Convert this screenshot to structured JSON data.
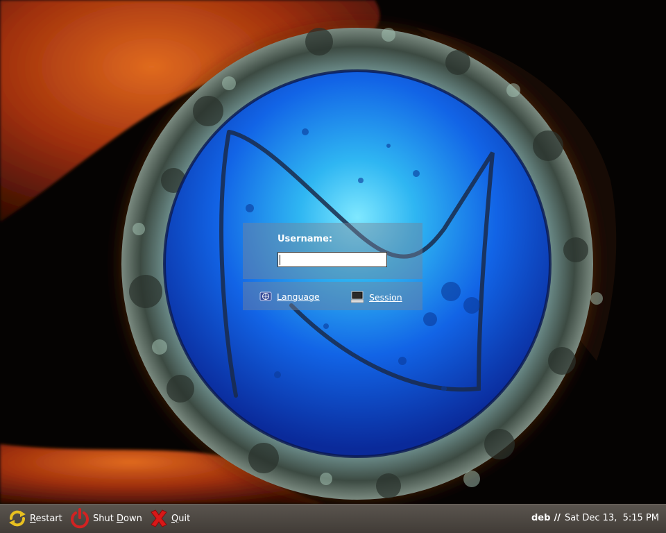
{
  "login": {
    "username_label": "Username:",
    "username_value": ""
  },
  "options": {
    "language_label": "Language",
    "session_label": "Session"
  },
  "bottom_bar": {
    "restart_label_first": "R",
    "restart_label_rest": "estart",
    "shutdown_label_first": "Shut ",
    "shutdown_label_u": "D",
    "shutdown_label_rest": "own",
    "quit_label_first": "Q",
    "quit_label_rest": "uit",
    "hostname": "deb",
    "separator": "//",
    "datetime": "Sat Dec 13,  5:15 PM"
  },
  "icons": {
    "restart": "restart-icon",
    "shutdown": "power-icon",
    "quit": "quit-x-icon",
    "language": "globe-icon",
    "session": "monitor-icon"
  },
  "colors": {
    "panel_bg": "#78829673",
    "bar_top": "#5a544e",
    "bar_bottom": "#413c37",
    "restart_yellow": "#e8c020",
    "shutdown_red": "#d22222",
    "quit_red": "#d81818"
  }
}
